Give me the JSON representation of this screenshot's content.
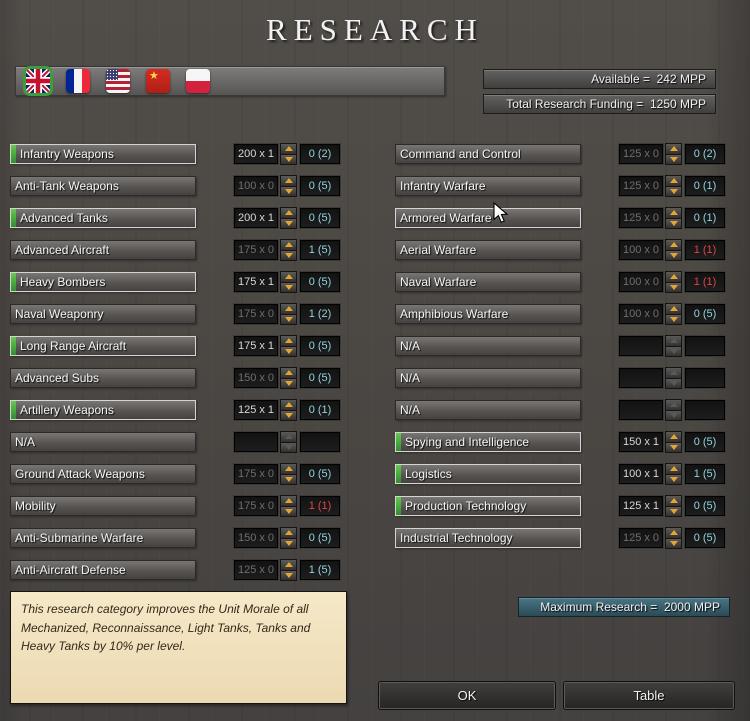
{
  "title": "RESEARCH",
  "flags": {
    "selected": "United Kingdom",
    "items": [
      "United Kingdom",
      "France",
      "United States",
      "Soviet Union",
      "Poland"
    ]
  },
  "summary": {
    "available": "Available =  242 MPP",
    "total": "Total Research Funding =  1250 MPP",
    "maximum": "Maximum Research =  2000 MPP"
  },
  "columns": {
    "left": [
      {
        "label": "Infantry Weapons",
        "cost": "200 x 1",
        "level": "0 (2)",
        "funded": true,
        "dim": false,
        "red": false,
        "na": false,
        "outlined": false
      },
      {
        "label": "Anti-Tank Weapons",
        "cost": "100 x 0",
        "level": "0 (5)",
        "funded": false,
        "dim": true,
        "red": false,
        "na": false,
        "outlined": false
      },
      {
        "label": "Advanced Tanks",
        "cost": "200 x 1",
        "level": "0 (5)",
        "funded": true,
        "dim": false,
        "red": false,
        "na": false,
        "outlined": false
      },
      {
        "label": "Advanced Aircraft",
        "cost": "175 x 0",
        "level": "1 (5)",
        "funded": false,
        "dim": true,
        "red": false,
        "na": false,
        "outlined": false
      },
      {
        "label": "Heavy Bombers",
        "cost": "175 x 1",
        "level": "0 (5)",
        "funded": true,
        "dim": false,
        "red": false,
        "na": false,
        "outlined": false
      },
      {
        "label": "Naval Weaponry",
        "cost": "175 x 0",
        "level": "1 (2)",
        "funded": false,
        "dim": true,
        "red": false,
        "na": false,
        "outlined": false
      },
      {
        "label": "Long Range Aircraft",
        "cost": "175 x 1",
        "level": "0 (5)",
        "funded": true,
        "dim": false,
        "red": false,
        "na": false,
        "outlined": false
      },
      {
        "label": "Advanced Subs",
        "cost": "150 x 0",
        "level": "0 (5)",
        "funded": false,
        "dim": true,
        "red": false,
        "na": false,
        "outlined": false
      },
      {
        "label": "Artillery Weapons",
        "cost": "125 x 1",
        "level": "0 (1)",
        "funded": true,
        "dim": false,
        "red": false,
        "na": false,
        "outlined": false
      },
      {
        "label": "N/A",
        "cost": "",
        "level": "",
        "funded": false,
        "dim": true,
        "red": false,
        "na": true,
        "outlined": false
      },
      {
        "label": "Ground Attack Weapons",
        "cost": "175 x 0",
        "level": "0 (5)",
        "funded": false,
        "dim": true,
        "red": false,
        "na": false,
        "outlined": false
      },
      {
        "label": "Mobility",
        "cost": "175 x 0",
        "level": "1 (1)",
        "funded": false,
        "dim": true,
        "red": true,
        "na": false,
        "outlined": false
      },
      {
        "label": "Anti-Submarine Warfare",
        "cost": "150 x 0",
        "level": "0 (5)",
        "funded": false,
        "dim": true,
        "red": false,
        "na": false,
        "outlined": false
      },
      {
        "label": "Anti-Aircraft Defense",
        "cost": "125 x 0",
        "level": "1 (5)",
        "funded": false,
        "dim": true,
        "red": false,
        "na": false,
        "outlined": false
      }
    ],
    "right": [
      {
        "label": "Command and Control",
        "cost": "125 x 0",
        "level": "0 (2)",
        "funded": false,
        "dim": true,
        "red": false,
        "na": false,
        "outlined": false
      },
      {
        "label": "Infantry Warfare",
        "cost": "125 x 0",
        "level": "0 (1)",
        "funded": false,
        "dim": true,
        "red": false,
        "na": false,
        "outlined": false
      },
      {
        "label": "Armored Warfare",
        "cost": "125 x 0",
        "level": "0 (1)",
        "funded": false,
        "dim": true,
        "red": false,
        "na": false,
        "outlined": true
      },
      {
        "label": "Aerial Warfare",
        "cost": "100 x 0",
        "level": "1 (1)",
        "funded": false,
        "dim": true,
        "red": true,
        "na": false,
        "outlined": false
      },
      {
        "label": "Naval Warfare",
        "cost": "100 x 0",
        "level": "1 (1)",
        "funded": false,
        "dim": true,
        "red": true,
        "na": false,
        "outlined": false
      },
      {
        "label": "Amphibious Warfare",
        "cost": "100 x 0",
        "level": "0 (5)",
        "funded": false,
        "dim": true,
        "red": false,
        "na": false,
        "outlined": false
      },
      {
        "label": "N/A",
        "cost": "",
        "level": "",
        "funded": false,
        "dim": true,
        "red": false,
        "na": true,
        "outlined": false
      },
      {
        "label": "N/A",
        "cost": "",
        "level": "",
        "funded": false,
        "dim": true,
        "red": false,
        "na": true,
        "outlined": false
      },
      {
        "label": "N/A",
        "cost": "",
        "level": "",
        "funded": false,
        "dim": true,
        "red": false,
        "na": true,
        "outlined": false
      },
      {
        "label": "Spying and Intelligence",
        "cost": "150 x 1",
        "level": "0 (5)",
        "funded": true,
        "dim": false,
        "red": false,
        "na": false,
        "outlined": false
      },
      {
        "label": "Logistics",
        "cost": "100 x 1",
        "level": "1 (5)",
        "funded": true,
        "dim": false,
        "red": false,
        "na": false,
        "outlined": false
      },
      {
        "label": "Production Technology",
        "cost": "125 x 1",
        "level": "0 (5)",
        "funded": true,
        "dim": false,
        "red": false,
        "na": false,
        "outlined": false
      },
      {
        "label": "Industrial Technology",
        "cost": "125 x 0",
        "level": "0 (5)",
        "funded": false,
        "dim": true,
        "red": false,
        "na": false,
        "outlined": true
      }
    ]
  },
  "tooltip": {
    "text": "This research category improves the Unit Morale of all Mechanized, Reconnaissance, Light Tanks, Tanks and Heavy Tanks by 10% per level."
  },
  "buttons": {
    "ok": "OK",
    "table": "Table"
  },
  "colors": {
    "funded_green": "#3fae3f",
    "level_teal": "#8fd4dc",
    "alert_red": "#e04545",
    "spinner_orange": "#e6a335",
    "tooltip_beige": "#f2e3c2"
  }
}
